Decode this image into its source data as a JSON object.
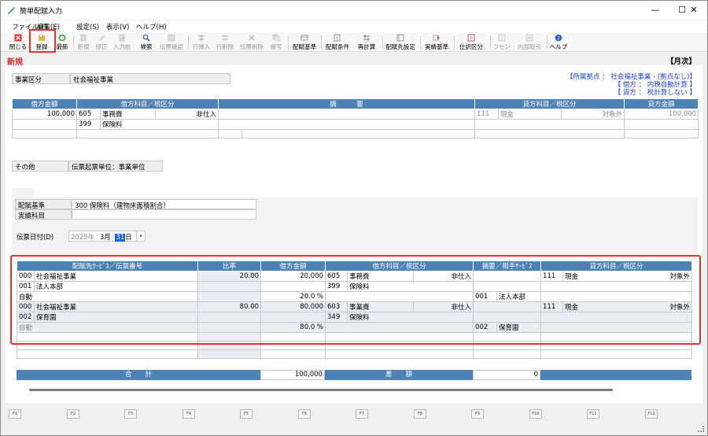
{
  "window": {
    "title": "簡単配賦入力",
    "controls": {
      "minimize": "—",
      "maximize": "☐",
      "close": "✕"
    }
  },
  "menu": [
    "ファイル(F)",
    "編集(E)",
    "設定(S)",
    "表示(V)",
    "ヘルプ(H)"
  ],
  "toolbar": [
    {
      "label": "閉じる",
      "icon": "close-icon",
      "color": "#d33"
    },
    {
      "label": "登録",
      "icon": "register-icon",
      "color": "#d9a21b"
    },
    {
      "label": "最新",
      "icon": "refresh-icon",
      "color": "#2f9a3a"
    },
    {
      "label": "新規",
      "icon": "new-icon",
      "disabled": true
    },
    {
      "label": "修正",
      "icon": "edit-icon",
      "disabled": true
    },
    {
      "label": "入力前",
      "icon": "before-icon",
      "disabled": true
    },
    {
      "label": "検索",
      "icon": "search-icon"
    },
    {
      "label": "伝票確認",
      "icon": "voucher-check-icon",
      "disabled": true
    },
    {
      "label": "行挿入",
      "icon": "row-insert-icon",
      "disabled": true
    },
    {
      "label": "行削除",
      "icon": "row-delete-icon",
      "disabled": true
    },
    {
      "label": "伝票削除",
      "icon": "voucher-delete-icon",
      "disabled": true
    },
    {
      "label": "複写",
      "icon": "copy-icon",
      "disabled": true
    },
    {
      "label": "配賦基準",
      "icon": "basis-icon"
    },
    {
      "label": "配賦条件",
      "icon": "condition-icon"
    },
    {
      "label": "再計算",
      "icon": "recalc-icon"
    },
    {
      "label": "配賦先設定",
      "icon": "target-icon"
    },
    {
      "label": "実績基準",
      "icon": "actual-icon",
      "color": "#c23"
    },
    {
      "label": "仕訳区分",
      "icon": "journal-icon",
      "color": "#c23"
    },
    {
      "label": "フセン",
      "icon": "sticky-icon",
      "disabled": true
    },
    {
      "label": "内部取引",
      "icon": "internal-icon",
      "disabled": true
    },
    {
      "label": "ヘルプ",
      "icon": "help-icon",
      "color": "#2a5fc8"
    }
  ],
  "status": {
    "mode": "新規",
    "period": "【月次】"
  },
  "business": {
    "label": "事業区分",
    "value": "社会福祉事業"
  },
  "note": {
    "line1": "【所属拠点 ： 社会福祉事業 - (拠点なし)】",
    "line2": "【 借方 ： 内税自動計算 】",
    "line3": "【 貸方 ： 税計算しない 】"
  },
  "journal": {
    "headers": [
      "借方金額",
      "借方科目／税区分",
      "摘　　　要",
      "貸方科目／税区分",
      "貸方金額"
    ],
    "debit_amount": "100,000",
    "debit_code": "605",
    "debit_name": "事務費",
    "debit_tax": "非仕入",
    "debit_sub_code": "399",
    "debit_sub_name": "保険料",
    "credit_code": "111",
    "credit_name": "現金",
    "credit_tax": "対象外",
    "credit_amount": "100,000"
  },
  "other": {
    "label": "その他",
    "value": "伝票起票単位：事業単位"
  },
  "allocation": {
    "basis_label": "配賦基準",
    "basis_value": "300 保険料（建物床面積割合）",
    "actual_label": "実績科目",
    "actual_value": ""
  },
  "date": {
    "label": "伝票日付(D)",
    "year": "2025年",
    "month": "3月",
    "day": "31",
    "day_unit": "日"
  },
  "grid": {
    "headers": [
      "配賦先ｻｰﾋﾞｽ／伝票番号",
      "比率",
      "借方金額",
      "借方科目／税区分",
      "摘要／相手ｻｰﾋﾞｽ",
      "貸方科目／税区分"
    ],
    "rows": [
      {
        "svc_code": "000",
        "svc_name": "社会福祉事業",
        "sub_code": "001",
        "sub_name": "法人本部",
        "auto": "自動",
        "ratio": "20.00",
        "amount": "20,000",
        "pct": "20.0 %",
        "debit_code": "605",
        "debit_name": "事務費",
        "debit_tax": "非仕入",
        "debit_sub_code": "399",
        "debit_sub_name": "保険料",
        "partner_code": "001",
        "partner_name": "法人本部",
        "credit_code": "111",
        "credit_name": "現金",
        "credit_tax": "対象外"
      },
      {
        "svc_code": "000",
        "svc_name": "社会福祉事業",
        "sub_code": "002",
        "sub_name": "保育園",
        "auto": "自動",
        "ratio": "80.00",
        "amount": "80,000",
        "pct": "80.0 %",
        "debit_code": "603",
        "debit_name": "事業費",
        "debit_tax": "非仕入",
        "debit_sub_code": "349",
        "debit_sub_name": "保険料",
        "partner_code": "002",
        "partner_name": "保育園",
        "credit_code": "111",
        "credit_name": "現金",
        "credit_tax": "対象外"
      }
    ],
    "total_label": "合　　計",
    "total_value": "100,000",
    "diff_label": "差　　額",
    "diff_value": "0"
  },
  "fkeys": [
    "F1",
    "F2",
    "F3",
    "F4",
    "F5",
    "F6",
    "F7",
    "F8",
    "F9",
    "F10",
    "F11",
    "F12"
  ]
}
